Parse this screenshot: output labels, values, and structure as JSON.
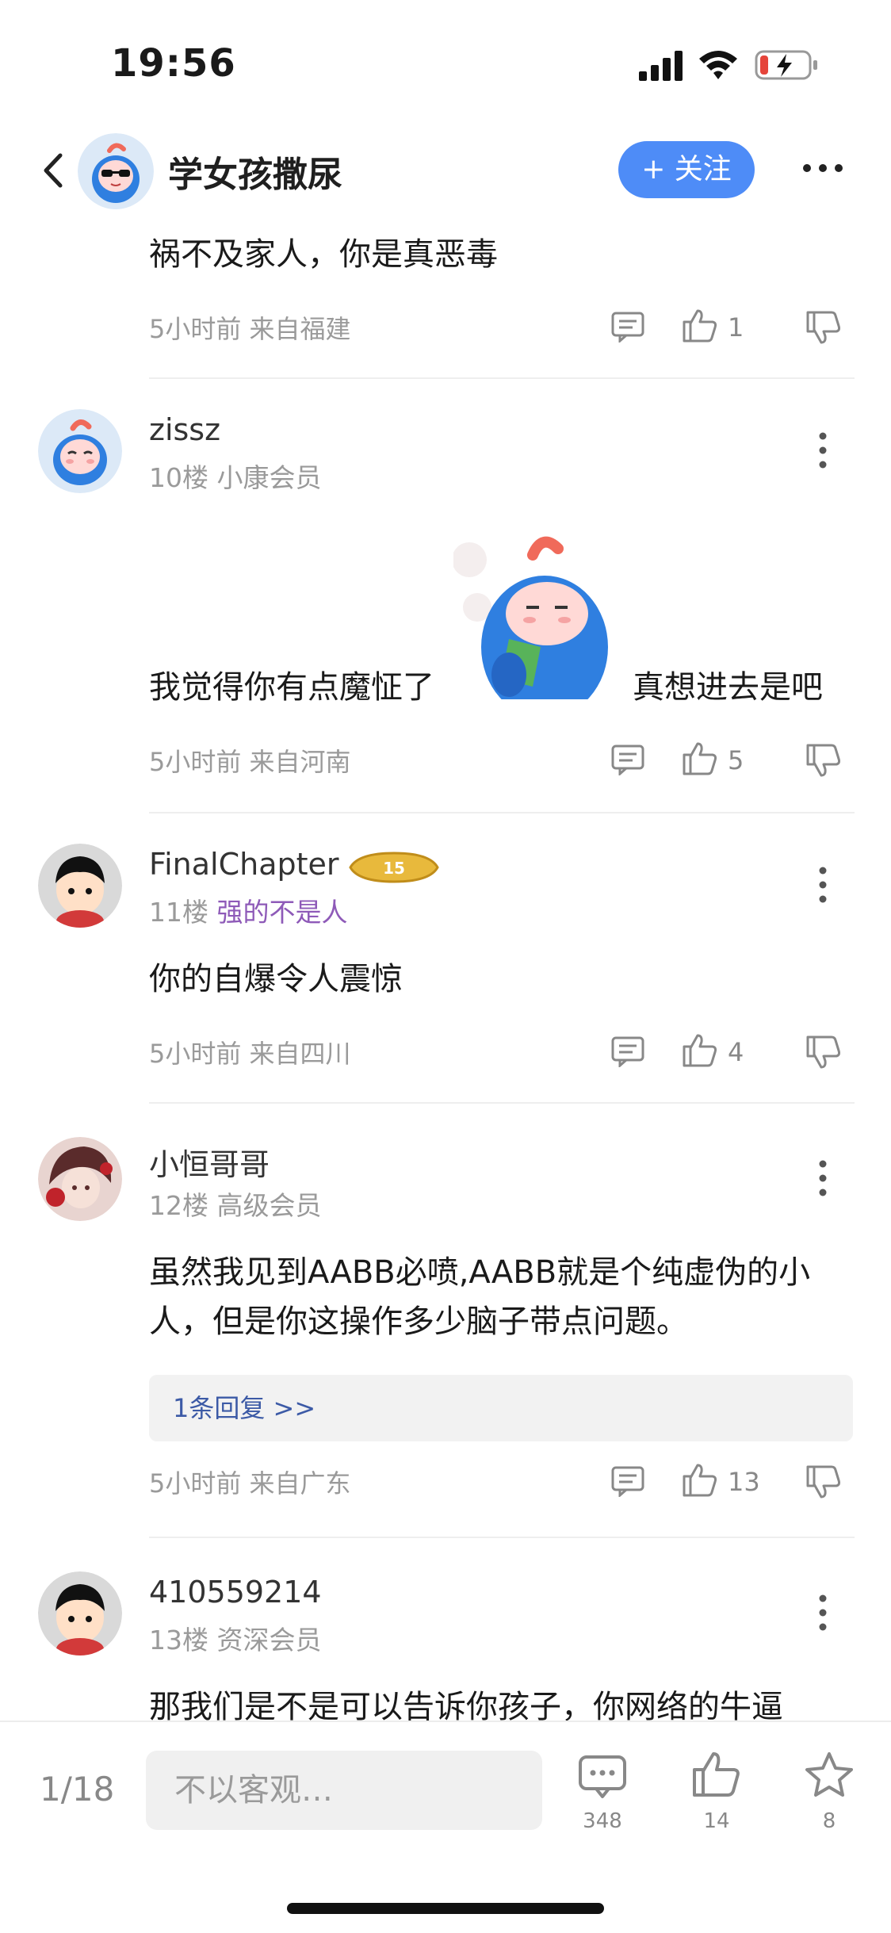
{
  "status": {
    "time": "19:56"
  },
  "nav": {
    "title": "学女孩撒尿",
    "follow_label": "+ 关注"
  },
  "comments": [
    {
      "text": "祸不及家人，你是真恶毒",
      "footer": "5小时前 来自福建",
      "likes": "1"
    },
    {
      "username": "zissz",
      "meta": "10楼 小康会员",
      "text_before": "我觉得你有点魔怔了",
      "text_after": "真想进去是吧",
      "footer": "5小时前 来自河南",
      "likes": "5"
    },
    {
      "username": "FinalChapter",
      "floor": "11楼",
      "title": "强的不是人",
      "badge_text": "15",
      "text": "你的自爆令人震惊",
      "footer": "5小时前 来自四川",
      "likes": "4"
    },
    {
      "username": "小恒哥哥",
      "meta": "12楼 高级会员",
      "text": "虽然我见到AABB必喷,AABB就是个纯虚伪的小人，但是你这操作多少脑子带点问题。",
      "reply_link": "1条回复 >>",
      "footer": "5小时前 来自广东",
      "likes": "13"
    },
    {
      "username": "410559214",
      "meta": "13楼 资深会员",
      "text": "那我们是不是可以告诉你孩子，你网络的牛逼"
    }
  ],
  "bottom": {
    "page_indicator": "1/18",
    "input_placeholder": "不以客观…",
    "comment_count": "348",
    "like_count": "14",
    "star_count": "8"
  },
  "colors": {
    "accent": "#4e8cf7",
    "title_purple": "#8e5ab8",
    "reply_link": "#3c5aa6"
  }
}
